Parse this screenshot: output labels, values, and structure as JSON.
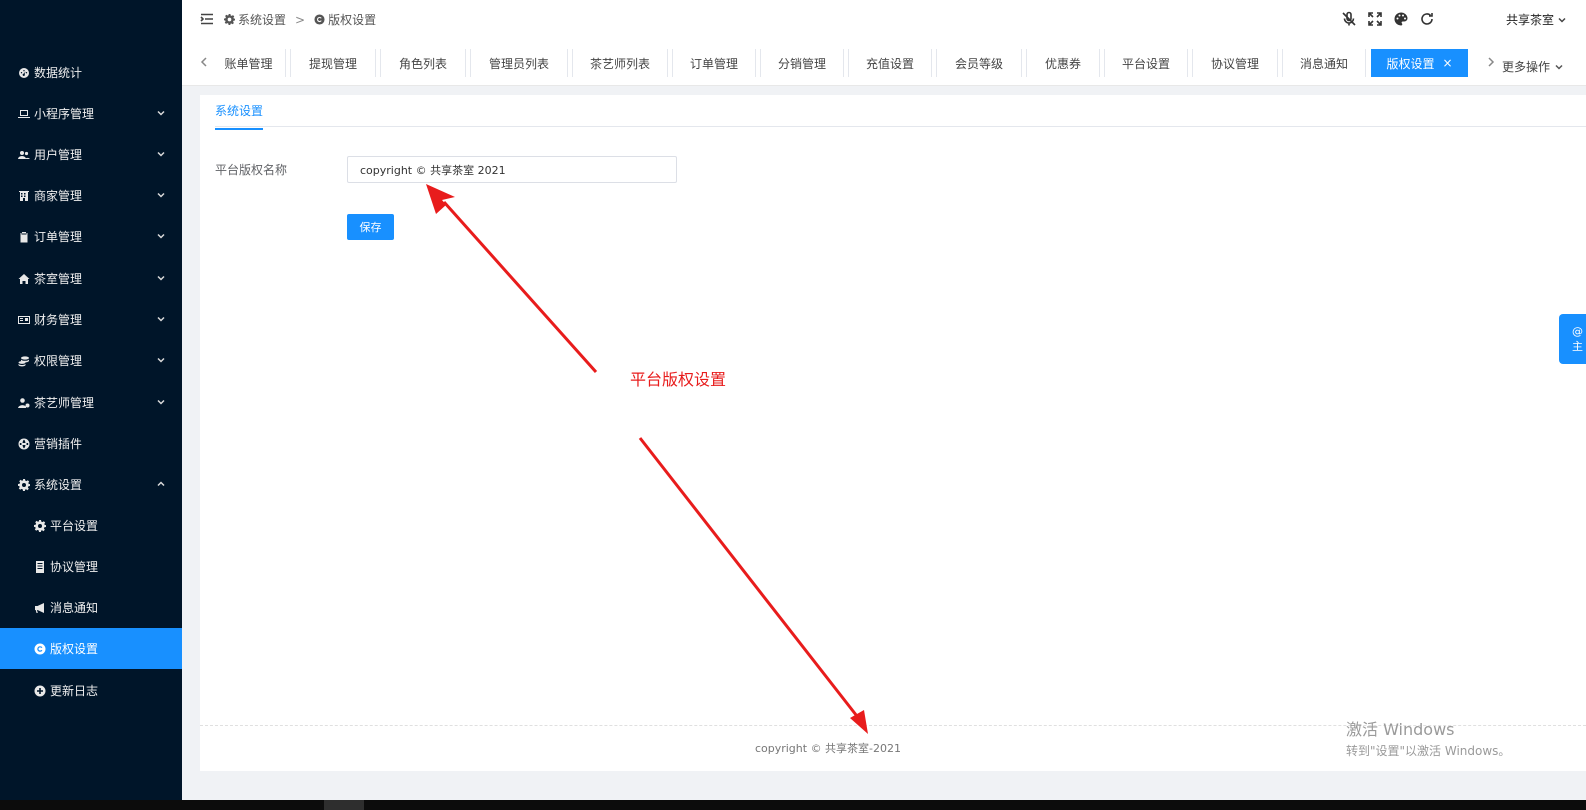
{
  "sidebar": {
    "items": [
      {
        "label": "数据统计",
        "icon": "dashboard-icon",
        "has_children": false,
        "expanded": false
      },
      {
        "label": "小程序管理",
        "icon": "laptop-icon",
        "has_children": true,
        "expanded": false
      },
      {
        "label": "用户管理",
        "icon": "users-icon",
        "has_children": true,
        "expanded": false
      },
      {
        "label": "商家管理",
        "icon": "building-icon",
        "has_children": true,
        "expanded": false
      },
      {
        "label": "订单管理",
        "icon": "clipboard-icon",
        "has_children": true,
        "expanded": false
      },
      {
        "label": "茶室管理",
        "icon": "home-icon",
        "has_children": true,
        "expanded": false
      },
      {
        "label": "财务管理",
        "icon": "ledger-icon",
        "has_children": true,
        "expanded": false
      },
      {
        "label": "权限管理",
        "icon": "coins-icon",
        "has_children": true,
        "expanded": false
      },
      {
        "label": "茶艺师管理",
        "icon": "user-cog-icon",
        "has_children": true,
        "expanded": false
      },
      {
        "label": "营销插件",
        "icon": "globe-icon",
        "has_children": false,
        "expanded": false
      },
      {
        "label": "系统设置",
        "icon": "gear-icon",
        "has_children": true,
        "expanded": true
      }
    ],
    "sub_items": [
      {
        "label": "平台设置",
        "icon": "gear-icon",
        "active": false
      },
      {
        "label": "协议管理",
        "icon": "document-icon",
        "active": false
      },
      {
        "label": "消息通知",
        "icon": "megaphone-icon",
        "active": false
      },
      {
        "label": "版权设置",
        "icon": "copyright-icon",
        "active": true
      },
      {
        "label": "更新日志",
        "icon": "plus-circle-icon",
        "active": false
      }
    ]
  },
  "header": {
    "breadcrumb": [
      {
        "label": "系统设置",
        "icon": "gear-icon"
      },
      {
        "label": "版权设置",
        "icon": "copyright-icon"
      }
    ],
    "breadcrumb_separator": ">",
    "icons": [
      "mic-off-icon",
      "fullscreen-icon",
      "palette-icon",
      "refresh-icon"
    ],
    "user_name": "共享茶室"
  },
  "tabs": {
    "items": [
      {
        "label": "账单管理",
        "active": false
      },
      {
        "label": "提现管理",
        "active": false
      },
      {
        "label": "角色列表",
        "active": false
      },
      {
        "label": "管理员列表",
        "active": false
      },
      {
        "label": "茶艺师列表",
        "active": false
      },
      {
        "label": "订单管理",
        "active": false
      },
      {
        "label": "分销管理",
        "active": false
      },
      {
        "label": "充值设置",
        "active": false
      },
      {
        "label": "会员等级",
        "active": false
      },
      {
        "label": "优惠券",
        "active": false
      },
      {
        "label": "平台设置",
        "active": false
      },
      {
        "label": "协议管理",
        "active": false
      },
      {
        "label": "消息通知",
        "active": false
      },
      {
        "label": "版权设置",
        "active": true
      }
    ],
    "close_glyph": "×",
    "more_label": "更多操作"
  },
  "main": {
    "section_tab": "系统设置",
    "form": {
      "label": "平台版权名称",
      "value": "copyright © 共享茶室 2021"
    },
    "save_label": "保存",
    "footer": "copyright © 共享茶室-2021"
  },
  "annotation": {
    "text": "平台版权设置",
    "color": "#e81c1c"
  },
  "watermark": {
    "line1": "激活 Windows",
    "line2": "转到\"设置\"以激活 Windows。"
  },
  "float_tab": {
    "line1": "@",
    "line2": "主"
  },
  "colors": {
    "accent": "#1890ff",
    "sidebar_bg": "#001529",
    "annotation_red": "#e81c1c"
  }
}
